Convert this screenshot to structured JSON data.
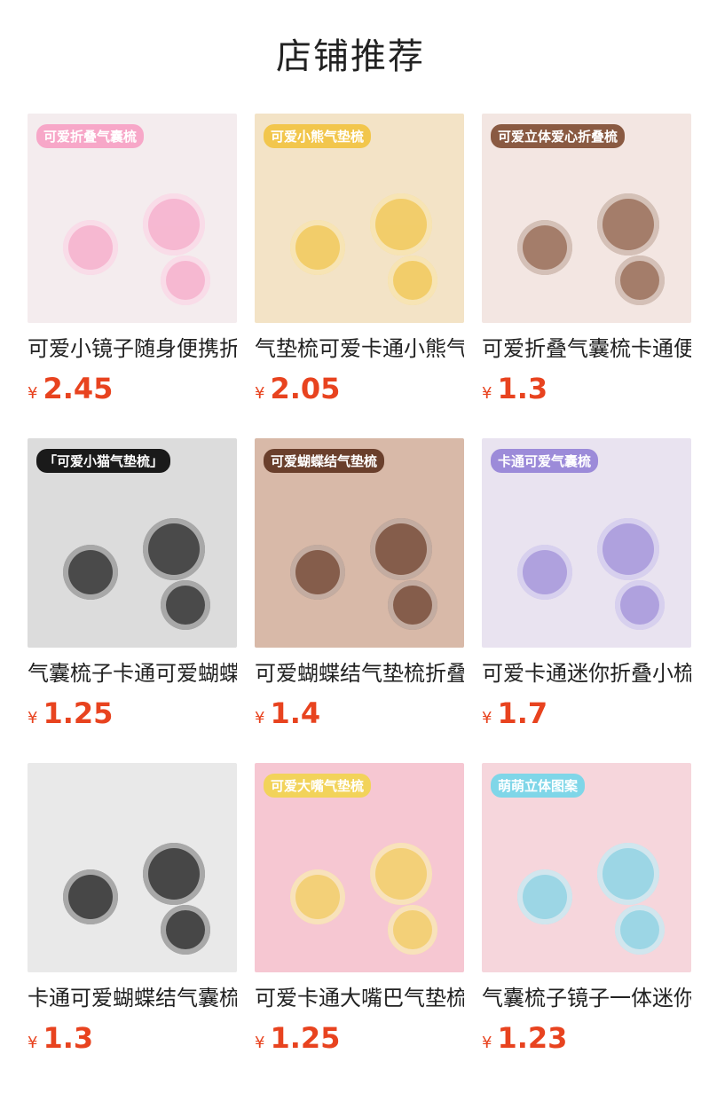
{
  "header": {
    "title": "店铺推荐"
  },
  "products": [
    {
      "name": "可爱小镜子随身便携折",
      "currency": "¥",
      "price": "2.45",
      "tag": "可爱折叠气囊梳",
      "bg": "#f4ecee",
      "accent": "#f7a7c8"
    },
    {
      "name": "气垫梳可爱卡通小熊气",
      "currency": "¥",
      "price": "2.05",
      "tag": "可爱小熊气垫梳",
      "bg": "#f3e3c6",
      "accent": "#f2c64c"
    },
    {
      "name": "可爱折叠气囊梳卡通便",
      "currency": "¥",
      "price": "1.3",
      "tag": "可爱立体爱心折叠梳",
      "bg": "#f3e6e2",
      "accent": "#8a5a42"
    },
    {
      "name": "气囊梳子卡通可爱蝴蝶",
      "currency": "¥",
      "price": "1.25",
      "tag": "「可爱小猫气垫梳」",
      "bg": "#dcdcdc",
      "accent": "#1a1a1a"
    },
    {
      "name": "可爱蝴蝶结气垫梳折叠",
      "currency": "¥",
      "price": "1.4",
      "tag": "可爱蝴蝶结气垫梳",
      "bg": "#d8b9a8",
      "accent": "#6a3f2c"
    },
    {
      "name": "可爱卡通迷你折叠小梳",
      "currency": "¥",
      "price": "1.7",
      "tag": "卡通可爱气囊梳",
      "bg": "#e9e3f0",
      "accent": "#9c8bd9"
    },
    {
      "name": "卡通可爱蝴蝶结气囊梳",
      "currency": "¥",
      "price": "1.3",
      "tag": "",
      "bg": "#e9e9e9",
      "accent": "#111111"
    },
    {
      "name": "可爱卡通大嘴巴气垫梳",
      "currency": "¥",
      "price": "1.25",
      "tag": "可爱大嘴气垫梳",
      "bg": "#f6c7d2",
      "accent": "#f2d35a"
    },
    {
      "name": "气囊梳子镜子一体迷你",
      "currency": "¥",
      "price": "1.23",
      "tag": "萌萌立体图案",
      "bg": "#f6d6dc",
      "accent": "#7fd6e8"
    }
  ]
}
